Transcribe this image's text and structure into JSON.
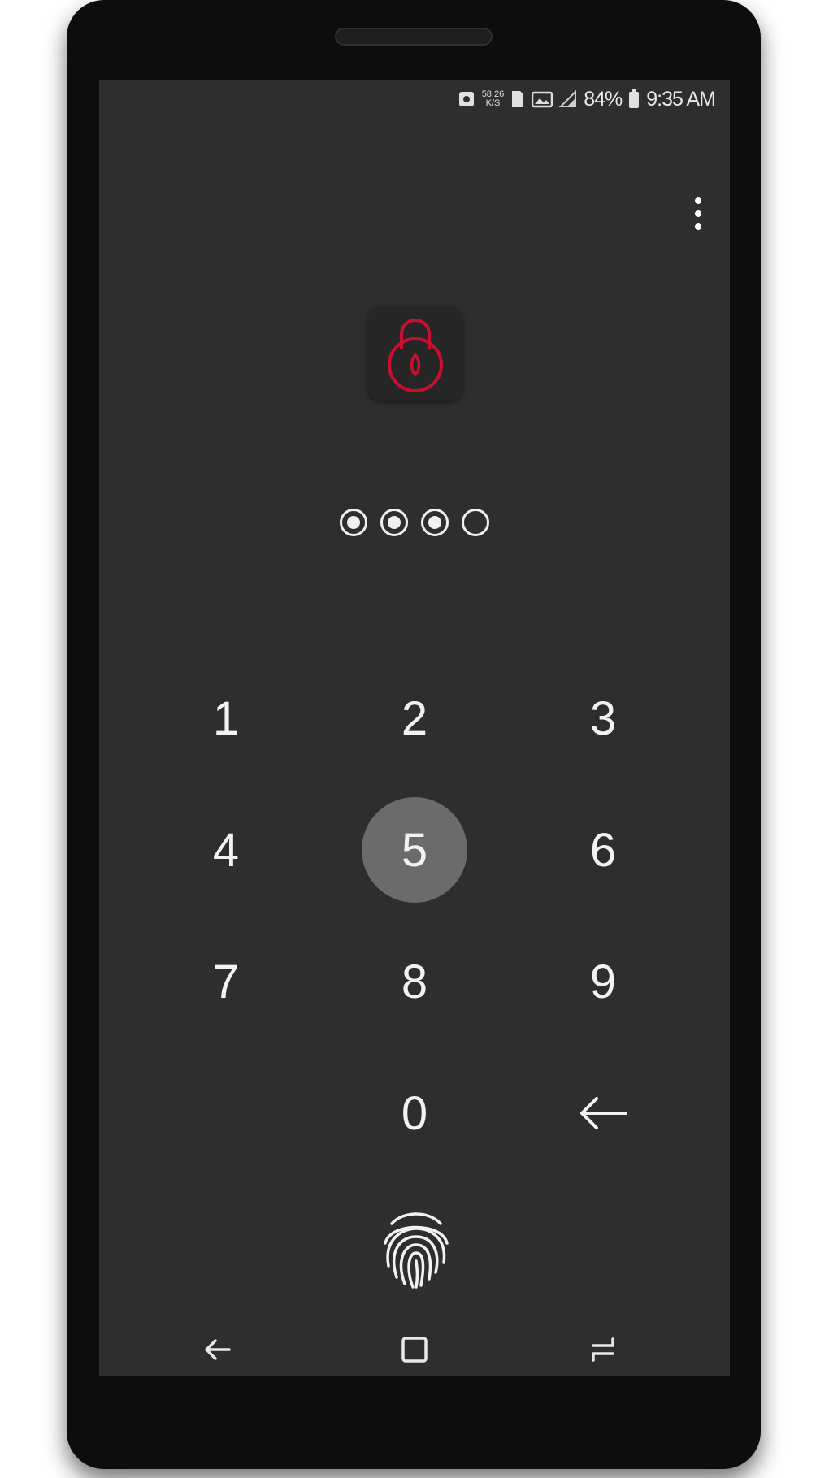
{
  "status_bar": {
    "speed_value": "58.26",
    "speed_unit": "K/S",
    "battery_percent": "84%",
    "time": "9:35 AM"
  },
  "lock_screen": {
    "pin_length": 4,
    "pin_entered": 3,
    "accent_color": "#c8102e"
  },
  "keypad": {
    "k1": "1",
    "k2": "2",
    "k3": "3",
    "k4": "4",
    "k5": "5",
    "k6": "6",
    "k7": "7",
    "k8": "8",
    "k9": "9",
    "k0": "0",
    "backspace": "←",
    "pressed_key": "5"
  },
  "icons": {
    "menu": "more-vert-icon",
    "lock": "padlock-icon",
    "fingerprint": "fingerprint-icon",
    "nav_back": "back-arrow-icon",
    "nav_home": "home-square-icon",
    "nav_recents": "recents-icon"
  }
}
